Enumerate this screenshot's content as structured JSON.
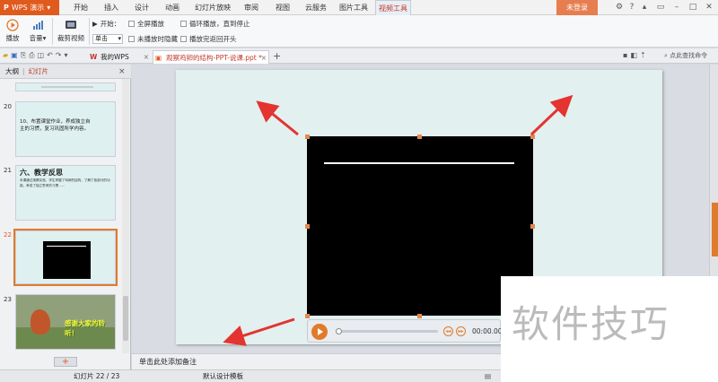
{
  "app": {
    "name": "WPS 演示"
  },
  "menu": [
    "开始",
    "插入",
    "设计",
    "动画",
    "幻灯片放映",
    "审阅",
    "视图",
    "云服务",
    "图片工具",
    "视频工具"
  ],
  "menu_active_index": 9,
  "login_label": "未登录",
  "ribbon": {
    "play_label": "播放",
    "volume_label": "音量",
    "trim_label": "裁剪视频",
    "start_label": "开始：",
    "start_value": "单击",
    "fullscreen_label": "全屏播放",
    "hide_label": "未播放时隐藏",
    "loop_label": "循环播放，直到停止",
    "rewind_label": "播放完返回开头"
  },
  "tabs": {
    "mywps": "我的WPS",
    "doc": "观察鸡卵的结构-PPT-说课.ppt *",
    "find_cmd": "点此查找命令"
  },
  "panel": {
    "outline_tab": "大纲",
    "slides_tab": "幻灯片"
  },
  "thumbs": [
    {
      "num": "20",
      "text": "10、布置课堂作业，养成独立自主的习惯，复习巩固所学内容。"
    },
    {
      "num": "21",
      "title": "六、教学反思",
      "text": "本课通过观察实验，学生掌握了鸡卵的结构，了解了各部分的功能，养成了独立思考的习惯……"
    },
    {
      "num": "22"
    },
    {
      "num": "23",
      "text": "感谢大家的聆听！"
    }
  ],
  "player": {
    "time": "00:00.00"
  },
  "notes_placeholder": "单击此处添加备注",
  "status": {
    "slide_info": "幻灯片 22 / 23",
    "template": "默认设计模板"
  },
  "watermark_text": "软件技巧"
}
